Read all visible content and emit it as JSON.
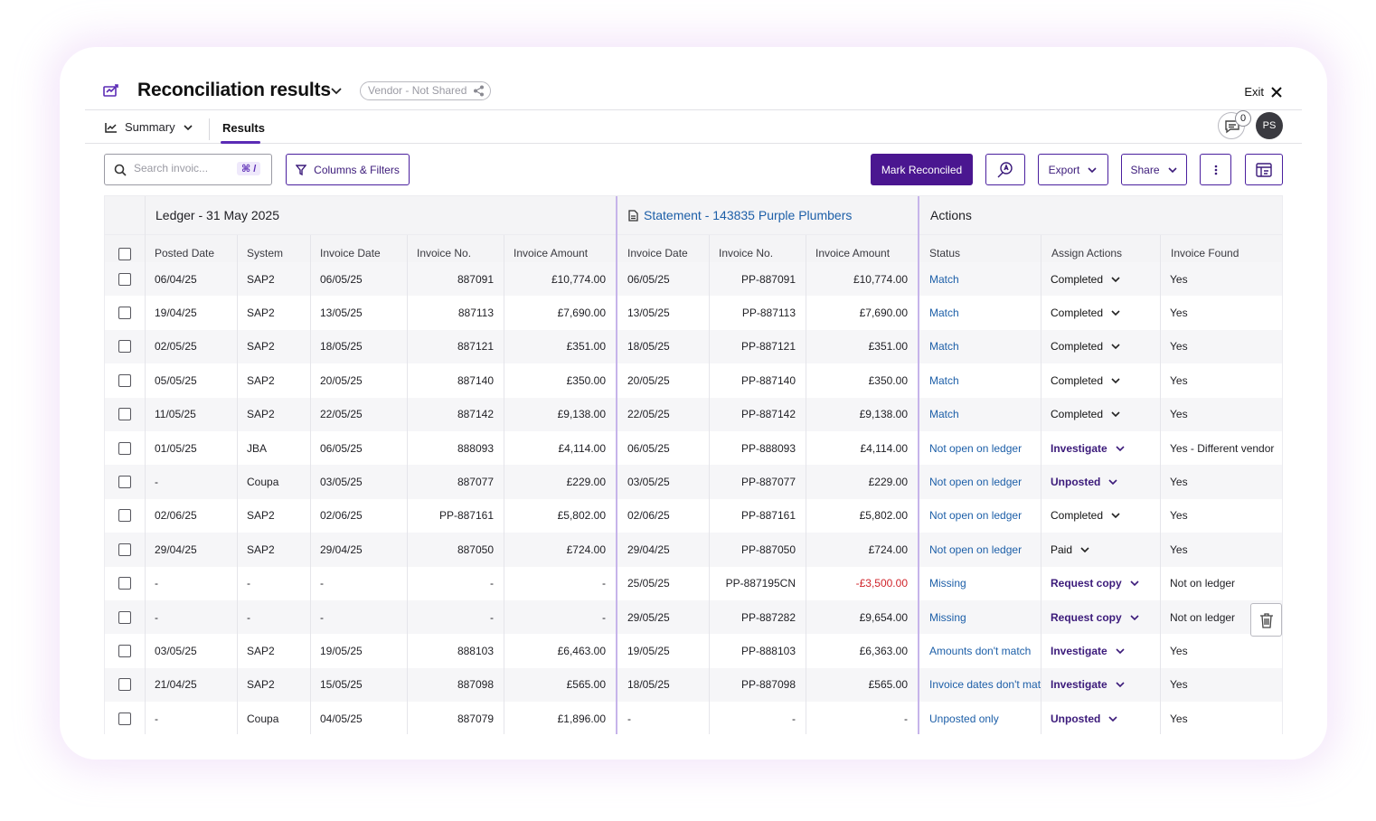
{
  "header": {
    "title": "Reconciliation results",
    "vendor_pill": "Vendor - Not Shared",
    "exit_label": "Exit"
  },
  "tabs": {
    "summary_label": "Summary",
    "results_label": "Results",
    "comment_count": "0",
    "avatar_initials": "PS"
  },
  "toolbar": {
    "search_placeholder": "Search invoic...",
    "search_shortcut": "⌘ /",
    "columns_filters_label": "Columns & Filters",
    "mark_reconciled_label": "Mark Reconciled",
    "export_label": "Export",
    "share_label": "Share"
  },
  "table": {
    "groups": {
      "ledger": "Ledger - 31 May 2025",
      "statement": "Statement - 143835 Purple Plumbers",
      "actions": "Actions"
    },
    "headers": {
      "posted_date": "Posted Date",
      "system": "System",
      "ledger_invoice_date": "Invoice Date",
      "ledger_invoice_no": "Invoice No.",
      "ledger_invoice_amount": "Invoice Amount",
      "stmt_invoice_date": "Invoice Date",
      "stmt_invoice_no": "Invoice No.",
      "stmt_invoice_amount": "Invoice Amount",
      "status": "Status",
      "assign_actions": "Assign Actions",
      "invoice_found": "Invoice Found"
    },
    "rows": [
      {
        "posted": "06/04/25",
        "system": "SAP2",
        "l_date": "06/05/25",
        "l_no": "887091",
        "l_amt": "£10,774.00",
        "s_date": "06/05/25",
        "s_no": "PP-887091",
        "s_amt": "£10,774.00",
        "status": "Match",
        "action": "Completed",
        "found": "Yes"
      },
      {
        "posted": "19/04/25",
        "system": "SAP2",
        "l_date": "13/05/25",
        "l_no": "887113",
        "l_amt": "£7,690.00",
        "s_date": "13/05/25",
        "s_no": "PP-887113",
        "s_amt": "£7,690.00",
        "status": "Match",
        "action": "Completed",
        "found": "Yes"
      },
      {
        "posted": "02/05/25",
        "system": "SAP2",
        "l_date": "18/05/25",
        "l_no": "887121",
        "l_amt": "£351.00",
        "s_date": "18/05/25",
        "s_no": "PP-887121",
        "s_amt": "£351.00",
        "status": "Match",
        "action": "Completed",
        "found": "Yes"
      },
      {
        "posted": "05/05/25",
        "system": "SAP2",
        "l_date": "20/05/25",
        "l_no": "887140",
        "l_amt": "£350.00",
        "s_date": "20/05/25",
        "s_no": "PP-887140",
        "s_amt": "£350.00",
        "status": "Match",
        "action": "Completed",
        "found": "Yes"
      },
      {
        "posted": "11/05/25",
        "system": "SAP2",
        "l_date": "22/05/25",
        "l_no": "887142",
        "l_amt": "£9,138.00",
        "s_date": "22/05/25",
        "s_no": "PP-887142",
        "s_amt": "£9,138.00",
        "status": "Match",
        "action": "Completed",
        "found": "Yes"
      },
      {
        "posted": "01/05/25",
        "system": "JBA",
        "l_date": "06/05/25",
        "l_no": "888093",
        "l_amt": "£4,114.00",
        "s_date": "06/05/25",
        "s_no": "PP-888093",
        "s_amt": "£4,114.00",
        "status": "Not open on ledger",
        "action": "Investigate",
        "found": "Yes - Different vendor"
      },
      {
        "posted": "-",
        "system": "Coupa",
        "l_date": "03/05/25",
        "l_no": "887077",
        "l_amt": "£229.00",
        "s_date": "03/05/25",
        "s_no": "PP-887077",
        "s_amt": "£229.00",
        "status": "Not open on ledger",
        "action": "Unposted",
        "found": "Yes"
      },
      {
        "posted": "02/06/25",
        "system": "SAP2",
        "l_date": "02/06/25",
        "l_no": "PP-887161",
        "l_amt": "£5,802.00",
        "s_date": "02/06/25",
        "s_no": "PP-887161",
        "s_amt": "£5,802.00",
        "status": "Not open on ledger",
        "action": "Completed",
        "found": "Yes"
      },
      {
        "posted": "29/04/25",
        "system": "SAP2",
        "l_date": "29/04/25",
        "l_no": "887050",
        "l_amt": "£724.00",
        "s_date": "29/04/25",
        "s_no": "PP-887050",
        "s_amt": "£724.00",
        "status": "Not open on ledger",
        "action": "Paid",
        "found": "Yes"
      },
      {
        "posted": "-",
        "system": "-",
        "l_date": "-",
        "l_no": "-",
        "l_amt": "-",
        "s_date": "25/05/25",
        "s_no": "PP-887195CN",
        "s_amt": "-£3,500.00",
        "status": "Missing",
        "action": "Request copy",
        "found": "Not on ledger"
      },
      {
        "posted": "-",
        "system": "-",
        "l_date": "-",
        "l_no": "-",
        "l_amt": "-",
        "s_date": "29/05/25",
        "s_no": "PP-887282",
        "s_amt": "£9,654.00",
        "status": "Missing",
        "action": "Request copy",
        "found": "Not on ledger"
      },
      {
        "posted": "03/05/25",
        "system": "SAP2",
        "l_date": "19/05/25",
        "l_no": "888103",
        "l_amt": "£6,463.00",
        "s_date": "19/05/25",
        "s_no": "PP-888103",
        "s_amt": "£6,363.00",
        "status": "Amounts don't match",
        "action": "Investigate",
        "found": "Yes"
      },
      {
        "posted": "21/04/25",
        "system": "SAP2",
        "l_date": "15/05/25",
        "l_no": "887098",
        "l_amt": "£565.00",
        "s_date": "18/05/25",
        "s_no": "PP-887098",
        "s_amt": "£565.00",
        "status": "Invoice dates don't mat",
        "action": "Investigate",
        "found": "Yes"
      },
      {
        "posted": "-",
        "system": "Coupa",
        "l_date": "04/05/25",
        "l_no": "887079",
        "l_amt": "£1,896.00",
        "s_date": "-",
        "s_no": "-",
        "s_amt": "-",
        "status": "Unposted only",
        "action": "Unposted",
        "found": "Yes"
      }
    ]
  },
  "colors": {
    "accent": "#5b2bb5",
    "primary_button": "#4a1690",
    "link": "#1d5fa8",
    "negative": "#d0242b"
  }
}
